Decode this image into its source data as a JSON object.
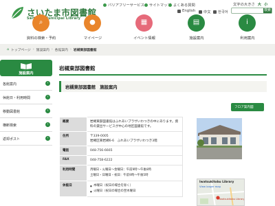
{
  "site": {
    "title": "さいたま市図書館",
    "subtitle": "Saitama Municipal Library"
  },
  "utility": {
    "barrier_free": "バリアフリーサービス",
    "sitemap": "サイトマップ",
    "faq": "よくある質問",
    "font_size_label": "文字の大きさ",
    "font_large": "大",
    "font_small": "小"
  },
  "languages": {
    "english": "English",
    "chinese": "中文",
    "korean": "한국어",
    "search_placeholder": "",
    "search_button": "検索"
  },
  "nav": [
    {
      "label": "資料の検索・予約",
      "icon": "search-icon"
    },
    {
      "label": "マイページ",
      "icon": "person-icon"
    },
    {
      "label": "イベント情報",
      "icon": "calendar-icon"
    },
    {
      "label": "施設案内",
      "icon": "book-icon"
    },
    {
      "label": "利用案内",
      "icon": "info-icon"
    }
  ],
  "breadcrumb": [
    "トップページ",
    "施設案内",
    "各館案内",
    "岩槻東部図書館"
  ],
  "sidebar": {
    "heading": "施設案内",
    "items": [
      "各館案内",
      "休館日・利用時間",
      "移動図書館",
      "横断検索",
      "返却ポスト"
    ]
  },
  "main": {
    "page_title": "岩槻東部図書館",
    "section_title": "岩槻東部図書館　施設案内",
    "floor_button": "フロア案内図",
    "table": {
      "overview_label": "概要",
      "overview_text": "岩槻東部図書館はふれあいプラザいわつきの中にあります。資料の貸出サービスが中心の地区図書館です。",
      "address_label": "住所",
      "address_postal": "〒339-0005",
      "address_line": "岩槻区東岩槻6-6　ふれあいプラザいわつき3階",
      "phone_label": "電話",
      "phone": "048-756-6665",
      "fax_label": "FAX",
      "fax": "048-758-6222",
      "hours_label": "利用時間",
      "hours_weekday": "月曜日・火曜日～金曜日：午前9時～午後8時",
      "hours_weekend": "土曜日・日曜日・祝日：午前9時～午後5時",
      "closed_label": "休館日",
      "closed_1": "木曜日（祝日の場合を除く）",
      "closed_2": "火曜日（祝日の場合の翌木曜日"
    },
    "map": {
      "title": "Iwatsukitobu Library",
      "link": "View larger map",
      "pin_label": "Iwatsukitobu Library"
    }
  },
  "colors": {
    "brand_green": "#2a8a42",
    "nav_orange": "#e9852b",
    "nav_pink": "#e66a7a"
  }
}
